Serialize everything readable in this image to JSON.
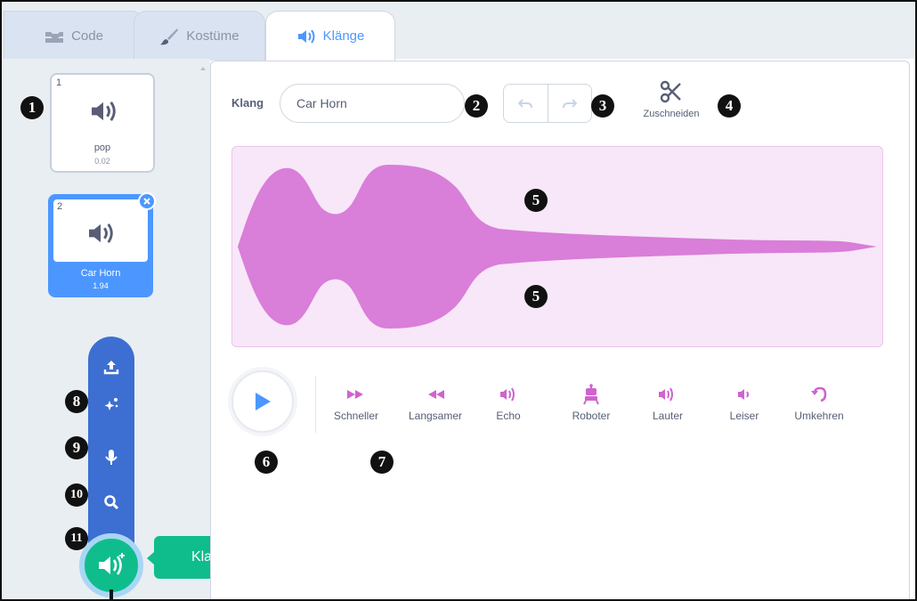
{
  "tabs": [
    {
      "label": "Code",
      "icon": "code-blocks-icon"
    },
    {
      "label": "Kostüme",
      "icon": "brush-icon"
    },
    {
      "label": "Klänge",
      "icon": "speaker-icon"
    }
  ],
  "sounds": [
    {
      "number": "1",
      "name": "pop",
      "duration": "0.02",
      "selected": false
    },
    {
      "number": "2",
      "name": "Car Horn",
      "duration": "1.94",
      "selected": true
    }
  ],
  "editor": {
    "name_label": "Klang",
    "name_value": "Car Horn",
    "trim_label": "Zuschneiden"
  },
  "effects": [
    {
      "label": "Schneller",
      "icon": "faster-icon"
    },
    {
      "label": "Langsamer",
      "icon": "slower-icon"
    },
    {
      "label": "Echo",
      "icon": "echo-icon"
    },
    {
      "label": "Roboter",
      "icon": "robot-icon"
    },
    {
      "label": "Lauter",
      "icon": "louder-icon"
    },
    {
      "label": "Leiser",
      "icon": "softer-icon"
    },
    {
      "label": "Umkehren",
      "icon": "reverse-icon"
    }
  ],
  "add_menu": {
    "items": [
      "upload-icon",
      "surprise-icon",
      "record-icon",
      "search-icon"
    ],
    "button_icon": "add-sound-icon",
    "tooltip": "Klang wählen"
  },
  "callouts": [
    "1",
    "2",
    "3",
    "4",
    "5",
    "5",
    "6",
    "7",
    "8",
    "9",
    "10",
    "11"
  ],
  "colors": {
    "accent": "#4c97ff",
    "menu": "#3c6fd1",
    "add": "#0fbd8c",
    "effect": "#cf63cf",
    "waveform": "#cf63cf"
  }
}
